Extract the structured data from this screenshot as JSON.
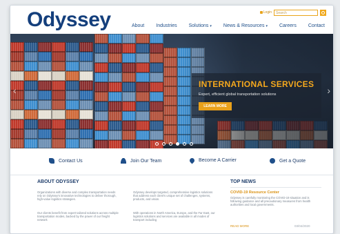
{
  "brand": {
    "logo_text": "Odyssey"
  },
  "utility": {
    "login_label": "Login",
    "search_placeholder": "Search"
  },
  "nav": {
    "items": [
      {
        "label": "About",
        "dropdown": false
      },
      {
        "label": "Industries",
        "dropdown": false
      },
      {
        "label": "Solutions",
        "dropdown": true
      },
      {
        "label": "News & Resources",
        "dropdown": true
      },
      {
        "label": "Careers",
        "dropdown": false
      },
      {
        "label": "Contact",
        "dropdown": false
      }
    ]
  },
  "hero": {
    "title": "INTERNATIONAL SERVICES",
    "subtitle": "Expert, efficient global transportation solutions",
    "button_label": "LEARN MORE",
    "slide_count": 6,
    "active_slide": 3
  },
  "quick_links": [
    {
      "label": "Contact Us",
      "icon": "phone-icon"
    },
    {
      "label": "Join Our Team",
      "icon": "user-icon"
    },
    {
      "label": "Become A Carrier",
      "icon": "pin-icon"
    },
    {
      "label": "Get a Quote",
      "icon": "quote-icon"
    }
  ],
  "about": {
    "heading": "ABOUT ODYSSEY",
    "col1_p1": "Organizations with diverse and complex transportation needs rely on Odyssey's innovative technologies to deliver thorough, high-value logistics strategies.",
    "col1_p2": "Our clients benefit from expert tailored solutions across multiple transportation modes, backed by the power of our freight network",
    "col2_p1": "Odyssey develops targeted, comprehensive logistics solutions that address each client's unique set of challenges, systems, products, and vision.",
    "col2_p2": "With operations in North America, Europe, and the Far East, our logistics solutions and services are available in all modes of transport including"
  },
  "news": {
    "heading": "TOP NEWS",
    "title": "COVID-19 Resource Center",
    "body": "Odyssey is carefully monitoring the COVID-19 situation and is following guidance and all precautionary measures from health authorities and local governments.",
    "more_label": "READ MORE",
    "date": "03/04/2020"
  },
  "colors": {
    "brand_blue": "#143f7c",
    "accent_orange": "#e9a11b"
  }
}
